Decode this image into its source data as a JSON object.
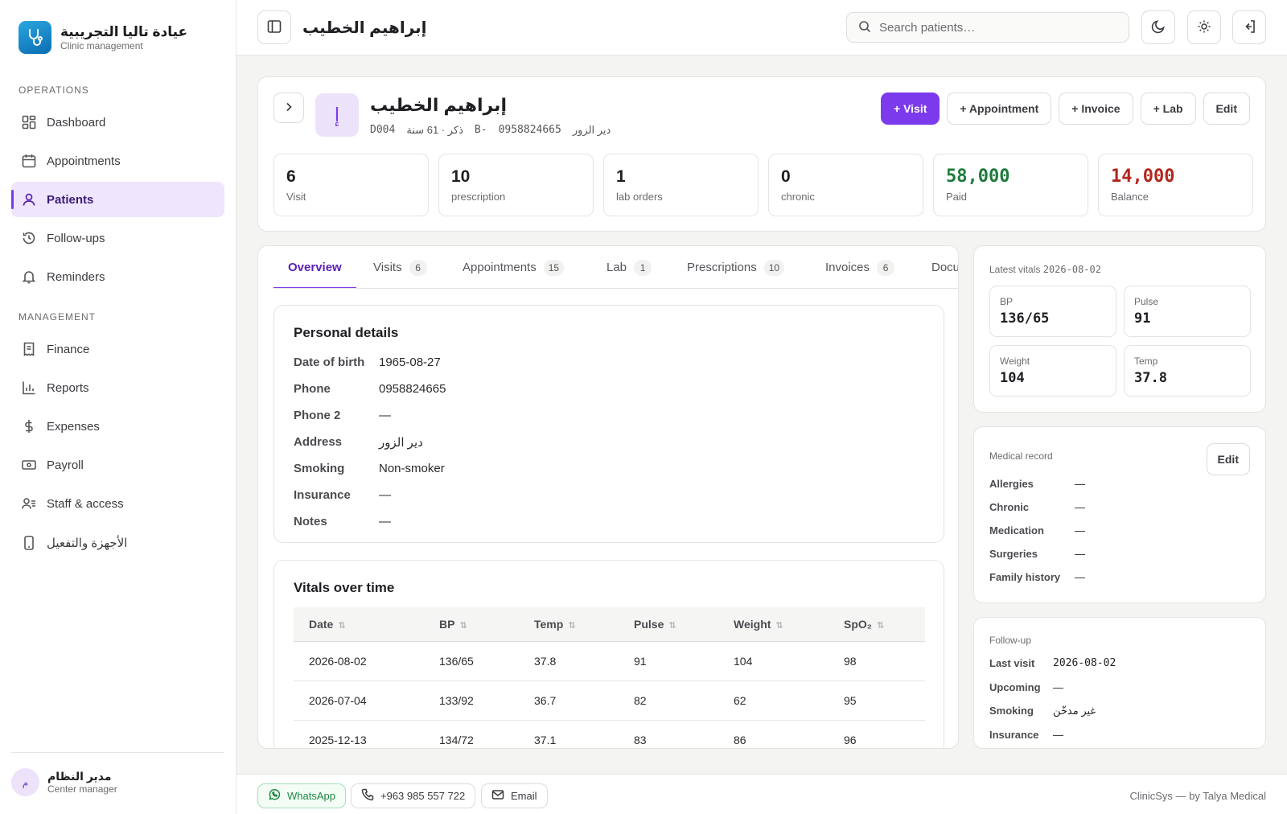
{
  "brand": {
    "name": "عيادة تاليا التجريبية",
    "subtitle": "Clinic management"
  },
  "sidebar": {
    "operations_label": "OPERATIONS",
    "management_label": "MANAGEMENT",
    "items": [
      {
        "label": "Dashboard",
        "icon": "grid-icon"
      },
      {
        "label": "Appointments",
        "icon": "calendar-icon"
      },
      {
        "label": "Patients",
        "icon": "user-icon",
        "active": true
      },
      {
        "label": "Follow-ups",
        "icon": "history-icon"
      },
      {
        "label": "Reminders",
        "icon": "bell-icon"
      },
      {
        "label": "Finance",
        "icon": "receipt-icon"
      },
      {
        "label": "Reports",
        "icon": "bar-chart-icon"
      },
      {
        "label": "Expenses",
        "icon": "dollar-icon"
      },
      {
        "label": "Payroll",
        "icon": "banknote-icon"
      },
      {
        "label": "Staff & access",
        "icon": "users-icon"
      },
      {
        "label": "الأجهزة والتفعيل",
        "icon": "smartphone-icon"
      }
    ],
    "user": {
      "initial": "م",
      "name": "مدير النظام",
      "role": "Center manager"
    }
  },
  "topbar": {
    "title": "إبراهيم الخطيب",
    "search_placeholder": "Search patients…"
  },
  "patient": {
    "avatar_initial": "إ",
    "name": "إبراهيم الخطيب",
    "code": "D004",
    "demographics": "ذكر · 61 سنة",
    "blood_type": "B-",
    "phone": "0958824665",
    "city": "دير الزور"
  },
  "actions": {
    "visit": "+ Visit",
    "appointment": "+ Appointment",
    "invoice": "+ Invoice",
    "lab": "+ Lab",
    "edit": "Edit"
  },
  "stats": [
    {
      "value": "6",
      "label": "Visit"
    },
    {
      "value": "10",
      "label": "prescription"
    },
    {
      "value": "1",
      "label": "lab orders"
    },
    {
      "value": "0",
      "label": "chronic"
    },
    {
      "value": "58,000",
      "label": "Paid",
      "color": "#1e7a3b"
    },
    {
      "value": "14,000",
      "label": "Balance",
      "color": "#b3261e"
    }
  ],
  "tabs": [
    {
      "label": "Overview",
      "count": "",
      "active": true
    },
    {
      "label": "Visits",
      "count": "6"
    },
    {
      "label": "Appointments",
      "count": "15"
    },
    {
      "label": "Lab",
      "count": "1"
    },
    {
      "label": "Prescriptions",
      "count": "10"
    },
    {
      "label": "Invoices",
      "count": "6"
    },
    {
      "label": "Docu",
      "count": ""
    }
  ],
  "personal": {
    "title": "Personal details",
    "rows": [
      {
        "k": "Date of birth",
        "v": "1965-08-27"
      },
      {
        "k": "Phone",
        "v": "0958824665"
      },
      {
        "k": "Phone 2",
        "v": "—"
      },
      {
        "k": "Address",
        "v": "دير الزور"
      },
      {
        "k": "Smoking",
        "v": "Non-smoker"
      },
      {
        "k": "Insurance",
        "v": "—"
      },
      {
        "k": "Notes",
        "v": "—"
      }
    ]
  },
  "vitals_table": {
    "title": "Vitals over time",
    "columns": [
      "Date",
      "BP",
      "Temp",
      "Pulse",
      "Weight",
      "SpO₂"
    ],
    "sort_glyph": "⇅",
    "rows": [
      [
        "2026-08-02",
        "136/65",
        "37.8",
        "91",
        "104",
        "98"
      ],
      [
        "2026-07-04",
        "133/92",
        "36.7",
        "82",
        "62",
        "95"
      ],
      [
        "2025-12-13",
        "134/72",
        "37.1",
        "83",
        "86",
        "96"
      ]
    ]
  },
  "latest_vitals": {
    "label": "Latest vitals",
    "date": "2026-08-02",
    "items": [
      {
        "k": "BP",
        "v": "136/65"
      },
      {
        "k": "Pulse",
        "v": "91"
      },
      {
        "k": "Weight",
        "v": "104"
      },
      {
        "k": "Temp",
        "v": "37.8"
      }
    ]
  },
  "medical_record": {
    "label": "Medical record",
    "edit": "Edit",
    "rows": [
      {
        "k": "Allergies",
        "v": "—"
      },
      {
        "k": "Chronic",
        "v": "—"
      },
      {
        "k": "Medication",
        "v": "—"
      },
      {
        "k": "Surgeries",
        "v": "—"
      },
      {
        "k": "Family history",
        "v": "—"
      }
    ]
  },
  "follow_up": {
    "label": "Follow-up",
    "rows": [
      {
        "k": "Last visit",
        "v": "2026-08-02"
      },
      {
        "k": "Upcoming",
        "v": "—"
      },
      {
        "k": "Smoking",
        "v": "غير مدخّن"
      },
      {
        "k": "Insurance",
        "v": "—"
      }
    ]
  },
  "footer": {
    "whatsapp": "WhatsApp",
    "phone": "+963 985 557 722",
    "email": "Email",
    "credit": "ClinicSys — by Talya Medical"
  },
  "colors": {
    "accent": "#7c3aed",
    "paid": "#1e7a3b",
    "balance": "#b3261e",
    "whatsapp": "#1e8a43"
  }
}
